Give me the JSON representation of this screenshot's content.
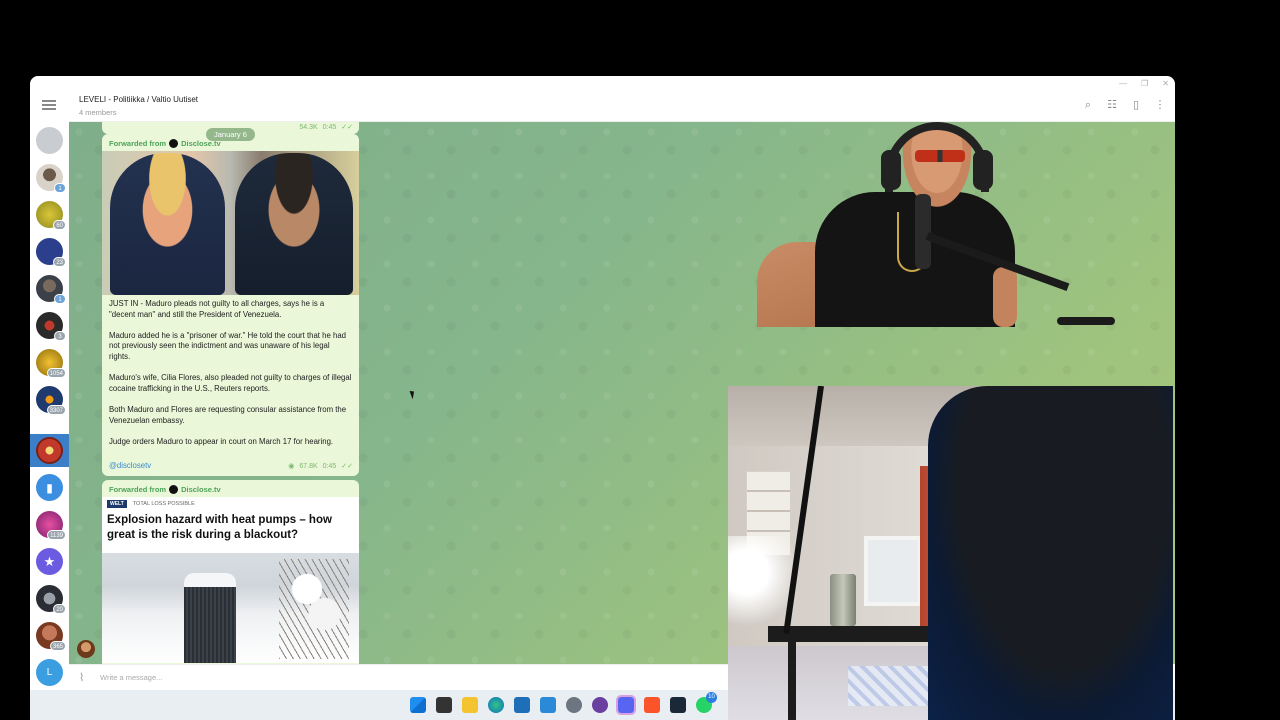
{
  "window": {
    "title": "LEVELI - Politiikka / Valtio Uutiset",
    "members": "4 members",
    "controls": [
      "—",
      "❐",
      "✕"
    ]
  },
  "rail": {
    "badges": [
      "1",
      "60",
      "23",
      "1",
      "3",
      "1054",
      "3307",
      "",
      "",
      "1139",
      "",
      "20",
      "365",
      ""
    ],
    "letter_avatar": "L"
  },
  "chat": {
    "date": "January 6",
    "prev_meta": {
      "views": "54.3K",
      "time": "0:45"
    },
    "message1": {
      "forwarded_label": "Forwarded from",
      "source": "Disclose.tv",
      "paragraphs": [
        "JUST IN - Maduro pleads not guilty to all charges, says he is a \"decent man\" and still the President of Venezuela.",
        "Maduro added he is a \"prisoner of war.\" He told the court that he had not previously seen the indictment and was unaware of his legal rights.",
        "Maduro's wife, Cilia Flores, also pleaded not guilty to charges of illegal cocaine trafficking in the U.S., Reuters reports.",
        "Both Maduro and Flores are requesting consular assistance from the Venezuelan embassy.",
        "Judge orders Maduro to appear in court on March 17 for hearing."
      ],
      "link": "@disclosetv",
      "views": "67.8K",
      "time": "0:45"
    },
    "message2": {
      "forwarded_label": "Forwarded from",
      "source": "Disclose.tv",
      "brand": "WELT",
      "tagline": "TOTAL LOSS POSSIBLE",
      "headline": "Explosion hazard with heat pumps – how great is the risk during a blackout?"
    }
  },
  "input": {
    "placeholder": "Write a message..."
  },
  "taskbar": {
    "badge": "10"
  },
  "colors": {
    "accent": "#3b7fc9",
    "bubble": "#eaf7d8",
    "forward": "#4fa45a",
    "link": "#3a8bd0"
  }
}
